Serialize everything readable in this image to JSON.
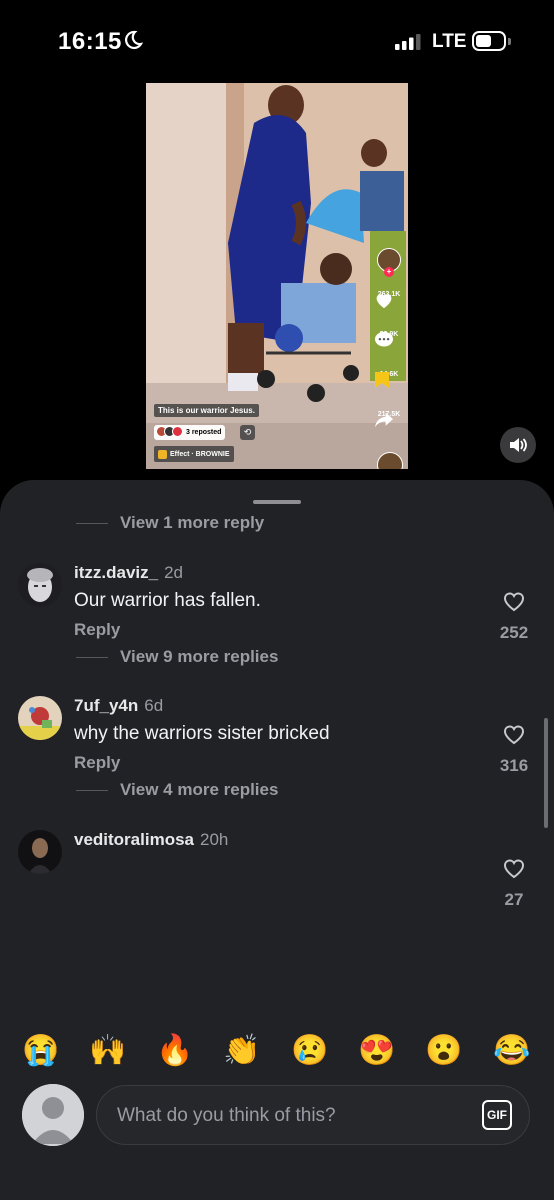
{
  "status_bar": {
    "time": "16:15",
    "network": "LTE"
  },
  "video": {
    "caption": "This is our warrior Jesus.",
    "repost_label": "3 reposted",
    "effect_label": "Effect · BROWNIE",
    "likes": "263.1K",
    "comments": "23.9K",
    "saves": "14.6K",
    "shares": "217.5K"
  },
  "comments": {
    "top_view_more": "View 1 more reply",
    "items": [
      {
        "username": "itzz.daviz_",
        "time": "2d",
        "text": "Our warrior has fallen.",
        "reply_label": "Reply",
        "likes": "252",
        "view_more": "View 9 more replies"
      },
      {
        "username": "7uf_y4n",
        "time": "6d",
        "text": "why the warriors sister bricked",
        "reply_label": "Reply",
        "likes": "316",
        "view_more": "View 4 more replies"
      },
      {
        "username": "veditoralimosa",
        "time": "20h",
        "likes": "27"
      }
    ]
  },
  "emojis": [
    "😭",
    "🙌",
    "🔥",
    "👏",
    "😢",
    "😍",
    "😮",
    "😂"
  ],
  "composer": {
    "placeholder": "What do you think of this?",
    "gif_label": "GIF"
  },
  "colors": {
    "sheet_bg": "#212226",
    "secondary_text": "#9a9ca3",
    "like_pink": "#fe2c55"
  }
}
